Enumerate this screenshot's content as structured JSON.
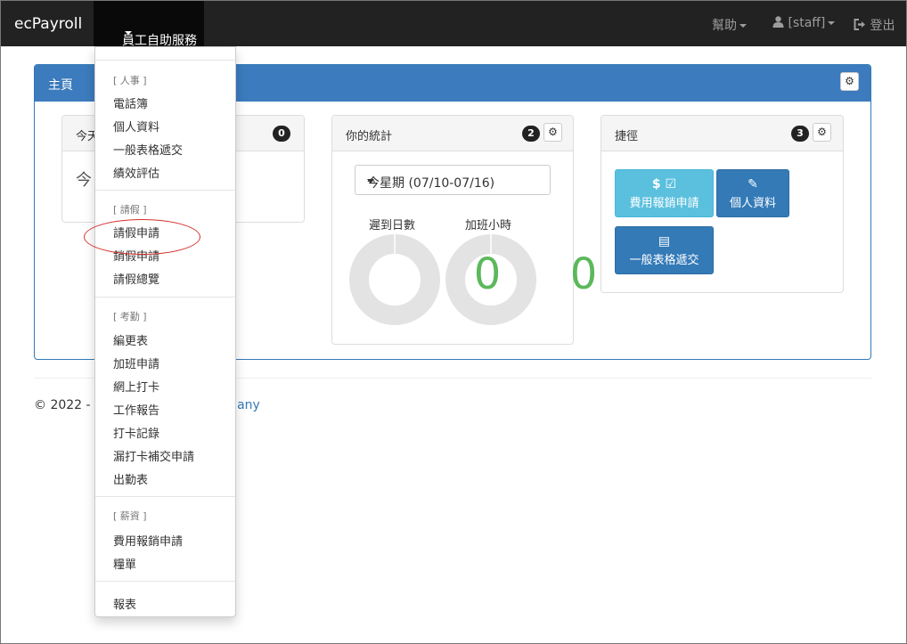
{
  "navbar": {
    "brand": "ecPayroll",
    "active_menu": "員工自助服務",
    "help": "幫助",
    "user": "[staff]",
    "logout": "登出"
  },
  "main_panel": {
    "title": "主頁"
  },
  "widget_today": {
    "title": "今天",
    "badge": "0",
    "body_text": "今"
  },
  "widget_stats": {
    "title": "你的統計",
    "badge": "2",
    "select_value": "今星期 (07/10-07/16)",
    "stats": [
      {
        "label": "遲到日數",
        "value": "0"
      },
      {
        "label": "加班小時",
        "value": "0"
      }
    ]
  },
  "widget_shortcuts": {
    "title": "捷徑",
    "badge": "3",
    "buttons": [
      {
        "label": "費用報銷申請",
        "icon": "dollar-edit-icon"
      },
      {
        "label": "個人資料",
        "icon": "pencil-icon"
      },
      {
        "label": "一般表格遞交",
        "icon": "form-icon"
      }
    ]
  },
  "footer": {
    "text": "© 2022 - F",
    "link_tail": "any"
  },
  "dropdown": {
    "sections": [
      {
        "header": "[ 人事 ]",
        "items": [
          "電話簿",
          "個人資料",
          "一般表格遞交",
          "績效評估"
        ]
      },
      {
        "header": "[ 請假 ]",
        "items": [
          "請假申請",
          "銷假申請",
          "請假總覽"
        ]
      },
      {
        "header": "[ 考勤 ]",
        "items": [
          "編更表",
          "加班申請",
          "網上打卡",
          "工作報告",
          "打卡記錄",
          "漏打卡補交申請",
          "出勤表"
        ]
      },
      {
        "header": "[ 薪資 ]",
        "items": [
          "費用報銷申請",
          "糧單"
        ]
      },
      {
        "header": "",
        "items": [
          "報表"
        ]
      }
    ]
  },
  "colors": {
    "navbar": "#222222",
    "primary": "#337ab7",
    "info": "#5bc0de",
    "success_number": "#5cb85c",
    "highlight_ellipse": "#d9302c"
  }
}
